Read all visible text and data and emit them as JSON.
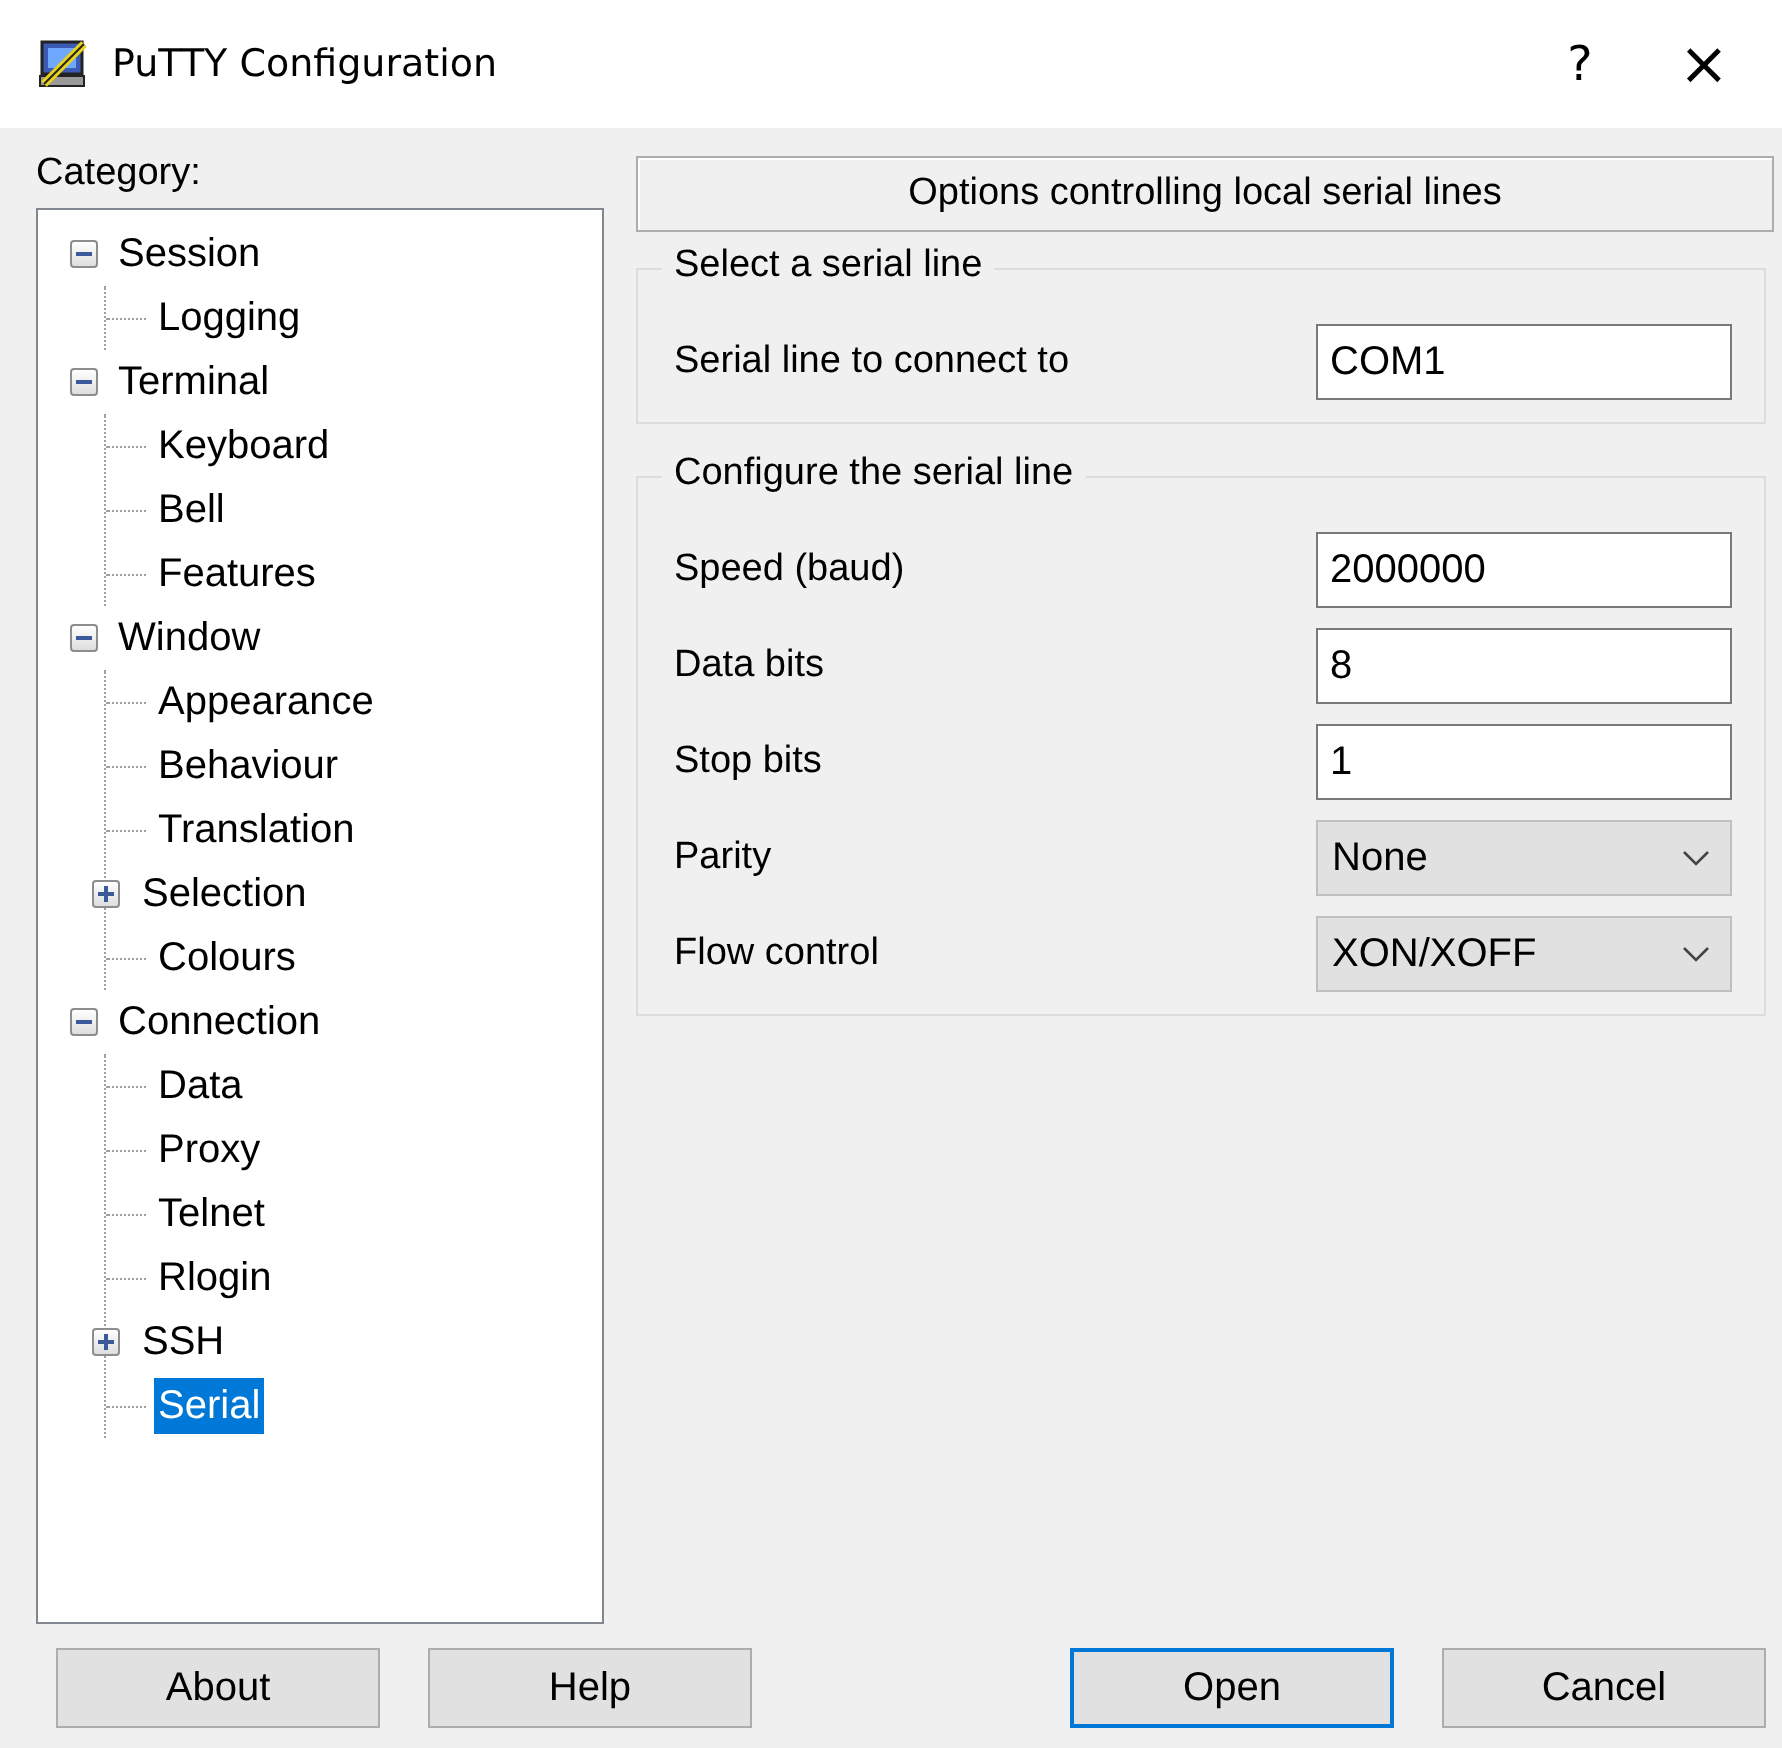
{
  "window": {
    "title": "PuTTY Configuration",
    "help_glyph": "?",
    "close_glyph": "×"
  },
  "category_label": "Category:",
  "tree": [
    {
      "label": "Session",
      "selected": false,
      "expanded": true,
      "children": [
        {
          "label": "Logging",
          "selected": false
        }
      ]
    },
    {
      "label": "Terminal",
      "selected": false,
      "expanded": true,
      "children": [
        {
          "label": "Keyboard",
          "selected": false
        },
        {
          "label": "Bell",
          "selected": false
        },
        {
          "label": "Features",
          "selected": false
        }
      ]
    },
    {
      "label": "Window",
      "selected": false,
      "expanded": true,
      "children": [
        {
          "label": "Appearance",
          "selected": false
        },
        {
          "label": "Behaviour",
          "selected": false
        },
        {
          "label": "Translation",
          "selected": false
        },
        {
          "label": "Selection",
          "selected": false,
          "expanded": false
        },
        {
          "label": "Colours",
          "selected": false
        }
      ]
    },
    {
      "label": "Connection",
      "selected": false,
      "expanded": true,
      "children": [
        {
          "label": "Data",
          "selected": false
        },
        {
          "label": "Proxy",
          "selected": false
        },
        {
          "label": "Telnet",
          "selected": false
        },
        {
          "label": "Rlogin",
          "selected": false
        },
        {
          "label": "SSH",
          "selected": false,
          "expanded": false
        },
        {
          "label": "Serial",
          "selected": true
        }
      ]
    }
  ],
  "panel_header": "Options controlling local serial lines",
  "groups": [
    {
      "title": "Select a serial line",
      "fields": [
        {
          "kind": "text",
          "label": "Serial line to connect to",
          "value": "COM1"
        }
      ]
    },
    {
      "title": "Configure the serial line",
      "fields": [
        {
          "kind": "text",
          "label": "Speed (baud)",
          "value": "2000000"
        },
        {
          "kind": "text",
          "label": "Data bits",
          "value": "8"
        },
        {
          "kind": "text",
          "label": "Stop bits",
          "value": "1"
        },
        {
          "kind": "dropdown",
          "label": "Parity",
          "value": "None"
        },
        {
          "kind": "dropdown",
          "label": "Flow control",
          "value": "XON/XOFF"
        }
      ]
    }
  ],
  "buttons": [
    {
      "label": "About",
      "default": false
    },
    {
      "label": "Help",
      "default": false
    },
    {
      "label": "Open",
      "default": true
    },
    {
      "label": "Cancel",
      "default": false
    }
  ]
}
